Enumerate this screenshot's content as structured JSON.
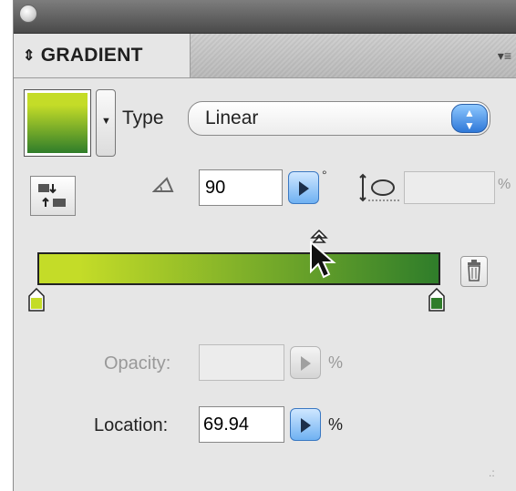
{
  "panel": {
    "tab_label": "GRADIENT",
    "tab_arrows": "⇕",
    "menu_glyph": "▾≡"
  },
  "gradient": {
    "start_color": "#c4dc28",
    "end_color": "#2f7d2a",
    "midpoint_location_percent": 69.94
  },
  "type": {
    "label": "Type",
    "value": "Linear"
  },
  "angle": {
    "value": "90",
    "unit_symbol": "°"
  },
  "aspect": {
    "unit_symbol": "%"
  },
  "opacity": {
    "label": "Opacity:",
    "value": "",
    "unit_symbol": "%"
  },
  "location": {
    "label": "Location:",
    "value": "69.94",
    "unit_symbol": "%"
  },
  "icons": {
    "close": "close-icon",
    "swatch_menu": "chevron-down-icon",
    "type_stepper": "stepper-icon",
    "reverse": "reverse-gradient-icon",
    "angle": "angle-icon",
    "aspect": "aspect-ratio-icon",
    "delete": "trash-icon",
    "cursor": "pointer-cursor-icon"
  }
}
